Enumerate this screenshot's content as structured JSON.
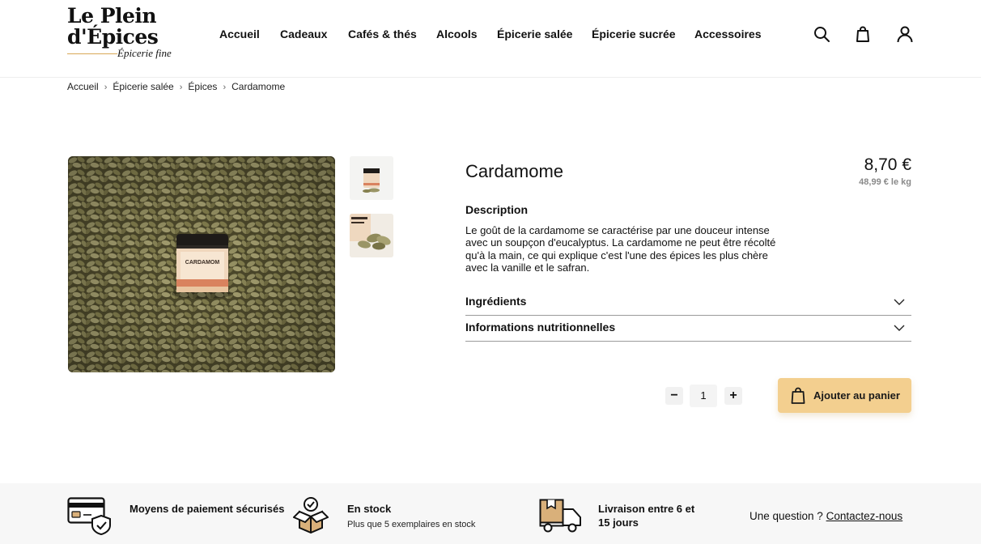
{
  "brand": {
    "line1": "Le Plein",
    "line2": "d'Épices",
    "tagline": "Épicerie fine"
  },
  "nav": {
    "items": [
      {
        "label": "Accueil"
      },
      {
        "label": "Cadeaux"
      },
      {
        "label": "Cafés & thés"
      },
      {
        "label": "Alcools"
      },
      {
        "label": "Épicerie salée"
      },
      {
        "label": "Épicerie sucrée"
      },
      {
        "label": "Accessoires"
      }
    ],
    "icons": [
      "search-icon",
      "shopping-bag-icon",
      "user-icon"
    ]
  },
  "breadcrumb": {
    "items": [
      "Accueil",
      "Épicerie salée",
      "Épices",
      "Cardamome"
    ],
    "separator": "›"
  },
  "product": {
    "title": "Cardamome",
    "price": "8,70 €",
    "price_per_kg": "48,99 € le kg",
    "image_jar_label": "CARDAMOM",
    "description_heading": "Description",
    "description": "Le goût de la cardamome se caractérise par une douceur intense avec un soupçon d'eucalyptus. La cardamome ne peut être récolté qu'à la main, ce qui explique c'est l'une des épices les plus chère avec la vanille et le safran.",
    "accordions": [
      {
        "label": "Ingrédients",
        "expanded": false
      },
      {
        "label": "Informations nutritionnelles",
        "expanded": false
      }
    ],
    "quantity": "1",
    "qty_minus": "−",
    "qty_plus": "+",
    "add_to_cart": "Ajouter au panier"
  },
  "features": [
    {
      "icon": "credit-card-shield-icon",
      "title": "Moyens de paiement sécurisés"
    },
    {
      "icon": "box-check-icon",
      "title": "En stock",
      "subtitle": "Plus que 5 exemplaires en stock"
    },
    {
      "icon": "delivery-truck-icon",
      "title": "Livraison entre 6 et 15 jours"
    }
  ],
  "contact": {
    "question": "Une question ?",
    "link": "Contactez-nous"
  },
  "colors": {
    "accent": "#f3cf8f",
    "icon_accent": "#d9b07a",
    "text": "#111111",
    "muted": "#8a8a8a",
    "strip": "#f7f7f7"
  }
}
